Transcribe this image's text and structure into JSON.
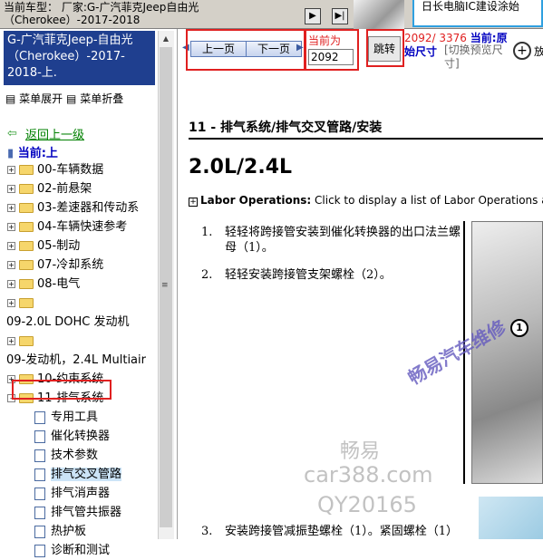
{
  "top": {
    "model_text": "当前车型：  厂家:G-广汽菲克Jeep自由光（Cherokee）-2017-2018",
    "brand_text": "日长电脑IC建设涂始"
  },
  "left_panel": {
    "model_title": "G-广汽菲克Jeep-自由光（Cherokee）-2017-2018-上.",
    "menu_expand": "菜单展开",
    "menu_collapse": "菜单折叠",
    "back_link": "返回上一级",
    "current": "当前:上",
    "tree": [
      {
        "label": "00-车辆数据",
        "type": "folder",
        "exp": "+"
      },
      {
        "label": "02-前悬架",
        "type": "folder",
        "exp": "+"
      },
      {
        "label": "03-差速器和传动系",
        "type": "folder",
        "exp": "+"
      },
      {
        "label": "04-车辆快速参考",
        "type": "folder",
        "exp": "+"
      },
      {
        "label": "05-制动",
        "type": "folder",
        "exp": "+"
      },
      {
        "label": "07-冷却系统",
        "type": "folder",
        "exp": "+"
      },
      {
        "label": "08-电气",
        "type": "folder",
        "exp": "+"
      },
      {
        "label": "",
        "type": "folder",
        "exp": "+"
      },
      {
        "label": "09-2.0L DOHC 发动机",
        "type": "text"
      },
      {
        "label": "",
        "type": "folder",
        "exp": "+"
      },
      {
        "label": "09-发动机，2.4L Multiair",
        "type": "text"
      },
      {
        "label": "10-约束系统",
        "type": "folder",
        "exp": "+"
      },
      {
        "label": "11-排气系统",
        "type": "folder",
        "exp": "-"
      }
    ],
    "children": [
      "专用工具",
      "催化转换器",
      "技术参数",
      "排气交叉管路",
      "排气消声器",
      "排气管共振器",
      "热护板",
      "诊断和测试"
    ],
    "selected_child": "排气交叉管路"
  },
  "toolbar": {
    "prev_label": "上一页",
    "next_label": "下一页",
    "current_label": "当前为",
    "page_value": "2092",
    "jump_label": "跳转",
    "page_count": "2092/ 3376",
    "current_text": "当前:原",
    "orig_size": "始尺寸",
    "switch_preview": "[切换预览尺寸]",
    "zoom_label": "放"
  },
  "content": {
    "section_title": "11 - 排气系统/排气交叉管路/安装",
    "engine_title": "2.0L/2.4L",
    "labor_bold": "Labor Operations:",
    "labor_text": " Click to display a list of Labor Operations as",
    "steps": [
      {
        "num": "1.",
        "text": "轻轻将跨接管安装到催化转换器的出口法兰螺母（1）。"
      },
      {
        "num": "2.",
        "text": "轻轻安装跨接管支架螺栓（2）。"
      },
      {
        "num": "3.",
        "text": "安装跨接管减振垫螺栓（1）。紧固螺栓（1）"
      }
    ],
    "callout": "1"
  },
  "watermarks": {
    "w1": "畅易汽车维修",
    "w2": "畅易",
    "w3": "car388.com",
    "w4": "QY20165"
  }
}
